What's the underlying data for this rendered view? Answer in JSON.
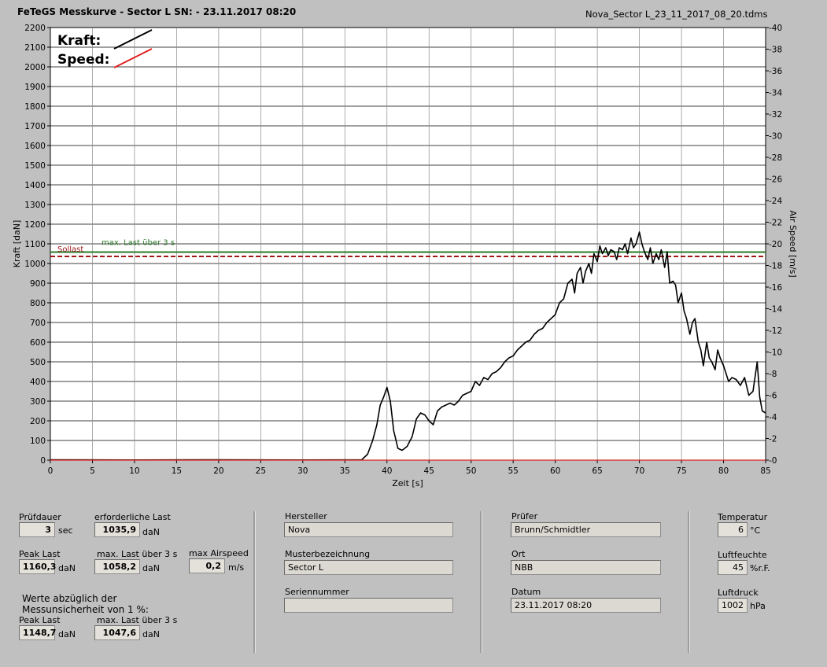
{
  "header": {
    "title": "FeTeGS Messkurve - Sector L  SN:  - 23.11.2017 08:20",
    "filename": "Nova_Sector L_23_11_2017_08_20.tdms"
  },
  "legend": {
    "kraft_label": "Kraft:",
    "speed_label": "Speed:"
  },
  "colors": {
    "kraft": "#000000",
    "speed": "#e02020",
    "max_last_line": "#2a7a2a",
    "sollast_line": "#a01818"
  },
  "chart_data": {
    "type": "line",
    "xlabel": "Zeit [s]",
    "ylabel": "Kraft [daN]",
    "y2label": "Air Speed [m/s]",
    "xlim": [
      0,
      85
    ],
    "ylim": [
      0,
      2200
    ],
    "y2lim": [
      0,
      40
    ],
    "x_ticks": [
      "0",
      "5",
      "10",
      "15",
      "20",
      "25",
      "30",
      "35",
      "40",
      "45",
      "50",
      "55",
      "60",
      "65",
      "70",
      "75",
      "80",
      "85"
    ],
    "y_ticks": [
      "0",
      "100",
      "200",
      "300",
      "400",
      "500",
      "600",
      "700",
      "800",
      "900",
      "1000",
      "1100",
      "1200",
      "1300",
      "1400",
      "1500",
      "1600",
      "1700",
      "1800",
      "1900",
      "2000",
      "2100",
      "2200"
    ],
    "y2_ticks": [
      "0",
      "2",
      "4",
      "6",
      "8",
      "10",
      "12",
      "14",
      "16",
      "18",
      "20",
      "22",
      "24",
      "26",
      "28",
      "30",
      "32",
      "34",
      "36",
      "38",
      "40"
    ],
    "grid": true,
    "annotations": {
      "max_last_label": "max. Last über  3 s",
      "max_last_value": 1058.2,
      "sollast_label": "Sollast",
      "sollast_value": 1035.9
    },
    "series": [
      {
        "name": "Kraft",
        "x": [
          0,
          10,
          20,
          30,
          37,
          37.7,
          38.3,
          38.8,
          39.2,
          39.6,
          40.0,
          40.4,
          40.8,
          41.3,
          41.8,
          42.4,
          43.0,
          43.5,
          44.0,
          44.5,
          45.0,
          45.5,
          46.0,
          46.5,
          47.0,
          47.5,
          48.0,
          48.5,
          49.0,
          49.5,
          50.0,
          50.5,
          51.0,
          51.5,
          52.0,
          52.5,
          53.0,
          53.5,
          54.0,
          54.5,
          55.0,
          55.5,
          56.0,
          56.5,
          57.0,
          57.5,
          58.0,
          58.5,
          59.0,
          59.5,
          60.0,
          60.5,
          61.0,
          61.5,
          62.0,
          62.3,
          62.6,
          63.0,
          63.3,
          63.6,
          64.0,
          64.3,
          64.6,
          65.0,
          65.3,
          65.6,
          66.0,
          66.3,
          66.6,
          67.0,
          67.3,
          67.6,
          68.0,
          68.3,
          68.6,
          69.0,
          69.3,
          69.6,
          70.0,
          70.3,
          70.6,
          71.0,
          71.3,
          71.6,
          72.0,
          72.3,
          72.6,
          73.0,
          73.3,
          73.6,
          74.0,
          74.3,
          74.6,
          75.0,
          75.3,
          75.6,
          76.0,
          76.3,
          76.6,
          77.0,
          77.3,
          77.6,
          78.0,
          78.3,
          78.6,
          79.0,
          79.3,
          79.6,
          80.0,
          80.3,
          80.6,
          81.0,
          81.5,
          82.0,
          82.5,
          83.0,
          83.5,
          84.0,
          84.3,
          84.6,
          85.0
        ],
        "y": [
          2,
          1,
          2,
          1,
          2,
          30,
          100,
          180,
          280,
          320,
          370,
          300,
          150,
          60,
          50,
          70,
          120,
          210,
          240,
          230,
          200,
          180,
          250,
          270,
          280,
          290,
          280,
          300,
          330,
          340,
          350,
          400,
          380,
          420,
          410,
          440,
          450,
          470,
          500,
          520,
          530,
          560,
          580,
          600,
          610,
          640,
          660,
          670,
          700,
          720,
          740,
          800,
          820,
          900,
          920,
          850,
          950,
          980,
          900,
          960,
          1000,
          950,
          1050,
          1010,
          1090,
          1050,
          1080,
          1040,
          1070,
          1060,
          1020,
          1080,
          1070,
          1100,
          1050,
          1130,
          1080,
          1100,
          1160,
          1100,
          1060,
          1020,
          1080,
          1000,
          1050,
          1020,
          1070,
          980,
          1060,
          900,
          910,
          890,
          800,
          850,
          760,
          720,
          640,
          700,
          720,
          600,
          560,
          480,
          600,
          520,
          500,
          460,
          560,
          520,
          480,
          440,
          400,
          420,
          410,
          380,
          420,
          330,
          350,
          500,
          320,
          250,
          240
        ],
        "color": "#000000"
      },
      {
        "name": "Speed",
        "x": [
          0,
          85
        ],
        "y": [
          0,
          0
        ],
        "color": "#e02020"
      }
    ]
  },
  "panel": {
    "pruefdauer": {
      "label": "Prüfdauer",
      "value": "3",
      "unit": "sec"
    },
    "erforderliche_last": {
      "label": "erforderliche Last",
      "value": "1035,9",
      "unit": "daN"
    },
    "peak_last": {
      "label": "Peak Last",
      "value": "1160,3",
      "unit": "daN"
    },
    "max_last": {
      "label": "max. Last über  3 s",
      "value": "1058,2",
      "unit": "daN"
    },
    "max_airspeed": {
      "label": "max Airspeed",
      "value": "0,2",
      "unit": "m/s"
    },
    "note_line1": "Werte abzüglich der",
    "note_line2": "Messunsicherheit von 1  %:",
    "peak_last2": {
      "label": "Peak Last",
      "value": "1148,7",
      "unit": "daN"
    },
    "max_last2": {
      "label": "max. Last über  3 s",
      "value": "1047,6",
      "unit": "daN"
    },
    "hersteller": {
      "label": "Hersteller",
      "value": "Nova"
    },
    "musterbezeichnung": {
      "label": "Musterbezeichnung",
      "value": "Sector L"
    },
    "seriennummer": {
      "label": "Seriennummer",
      "value": ""
    },
    "pruefer": {
      "label": "Prüfer",
      "value": "Brunn/Schmidtler"
    },
    "ort": {
      "label": "Ort",
      "value": "NBB"
    },
    "datum": {
      "label": "Datum",
      "value": "23.11.2017 08:20"
    },
    "temperatur": {
      "label": "Temperatur",
      "value": "6",
      "unit": "°C"
    },
    "luftfeuchte": {
      "label": "Luftfeuchte",
      "value": "45",
      "unit": "%r.F."
    },
    "luftdruck": {
      "label": "Luftdruck",
      "value": "1002",
      "unit": "hPa"
    }
  }
}
